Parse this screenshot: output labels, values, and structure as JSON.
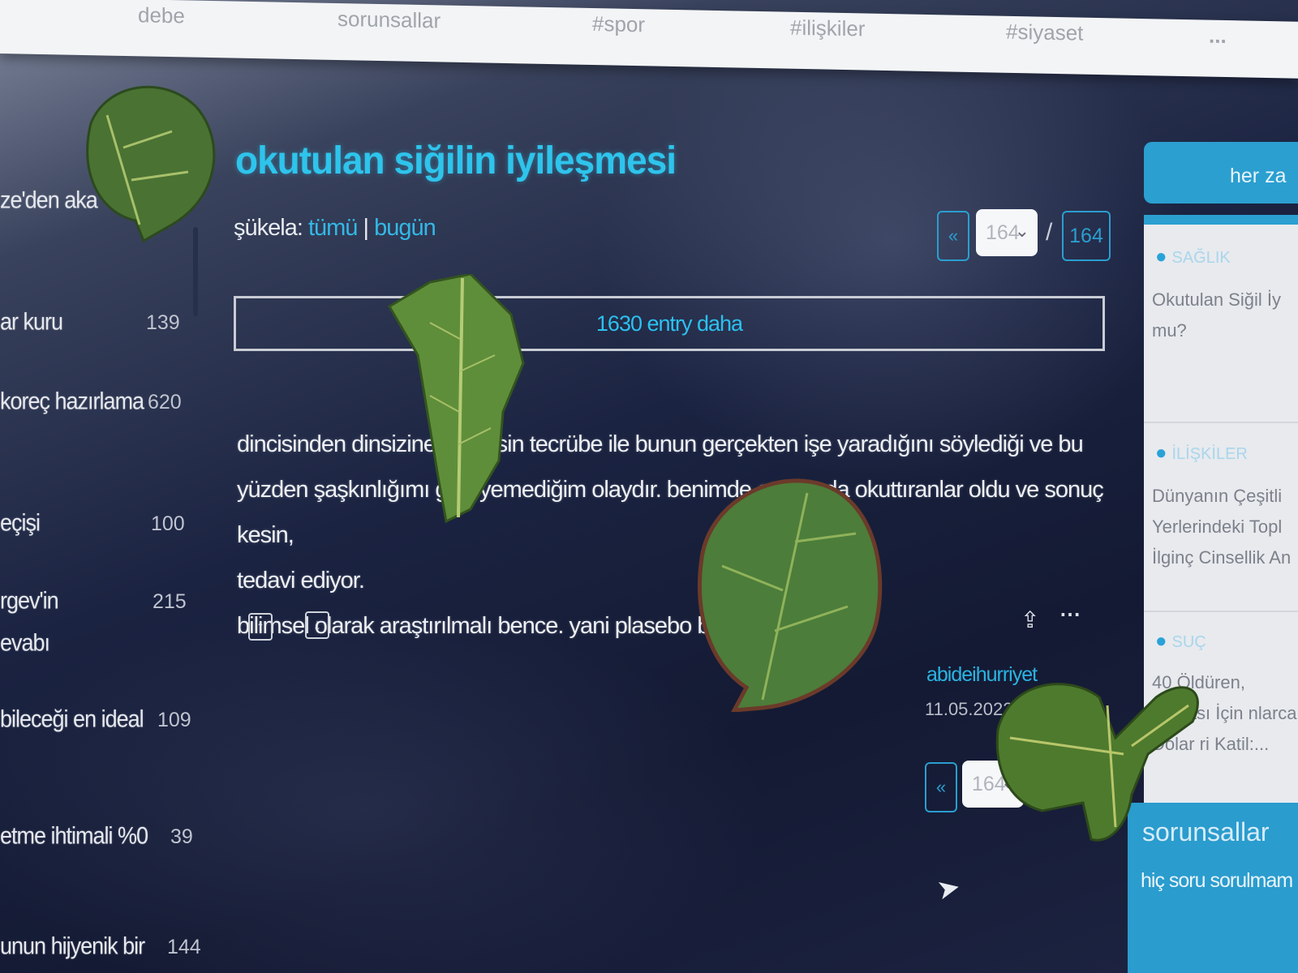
{
  "top_nav": {
    "items": [
      "debe",
      "sorunsallar",
      "#spor",
      "#ilişkiler",
      "#siyaset",
      "..."
    ]
  },
  "left_sidebar": {
    "rows": [
      {
        "label": "ze'den aka",
        "count": ""
      },
      {
        "label": "ar kuru",
        "count": "139"
      },
      {
        "label": "koreç hazırlama",
        "count": "620"
      },
      {
        "label": "eçişi",
        "count": "100"
      },
      {
        "label": "rgev'in",
        "count": "215"
      },
      {
        "label": "evabı",
        "count": ""
      },
      {
        "label": "bileceği en ideal",
        "count": "109"
      },
      {
        "label": "etme ihtimali %0",
        "count": "39"
      },
      {
        "label": "unun hijyenik bir",
        "count": "144"
      }
    ]
  },
  "topic": {
    "title": "okutulan siğilin iyileşmesi",
    "sukela_label": "şükela:",
    "filter_all": "tümü",
    "filter_sep": "|",
    "filter_today": "bugün",
    "more_entries": "1630 entry daha"
  },
  "pager": {
    "prev_label": "«",
    "current_page": "164",
    "separator": "/",
    "total_pages": "164"
  },
  "entry": {
    "line1": "dincisinden dinsizine herkesin tecrübe ile bunun gerçekten işe yaradığını söylediği ve bu",
    "line2": "yüzden şaşkınlığımı gizleyemediğim olaydır. benimde etrafımda okuttıranlar oldu ve sonuç kesin,",
    "line3": "tedavi ediyor.",
    "line4": "bilimsel olarak araştırılmalı bence. yani plasebo b",
    "author": "abideihurriyet",
    "date": "11.05.2022"
  },
  "right_sidebar": {
    "header": "her za",
    "items": [
      {
        "category": "SAĞLIK",
        "text": "Okutulan Siğil İy mu?"
      },
      {
        "category": "İLİŞKİLER",
        "text": "Dünyanın Çeşitli Yerlerindeki Topl İlginç Cinsellik An"
      },
      {
        "category": "SUÇ",
        "text": "40 Öldüren, anması İçin nlarca Dolar ri Katil:..."
      }
    ],
    "footer_title": "sorunsallar",
    "footer_text": "hiç soru sorulmam"
  },
  "colors": {
    "accent": "#2ec4ec",
    "link": "#33b8e6",
    "background": "#141a33",
    "leaf_green": "#4d7a36"
  },
  "overlays": {
    "leaves": [
      "potato-leaf",
      "tomato-leaf",
      "potato-leaf",
      "tomato-leaf-cluster"
    ]
  }
}
